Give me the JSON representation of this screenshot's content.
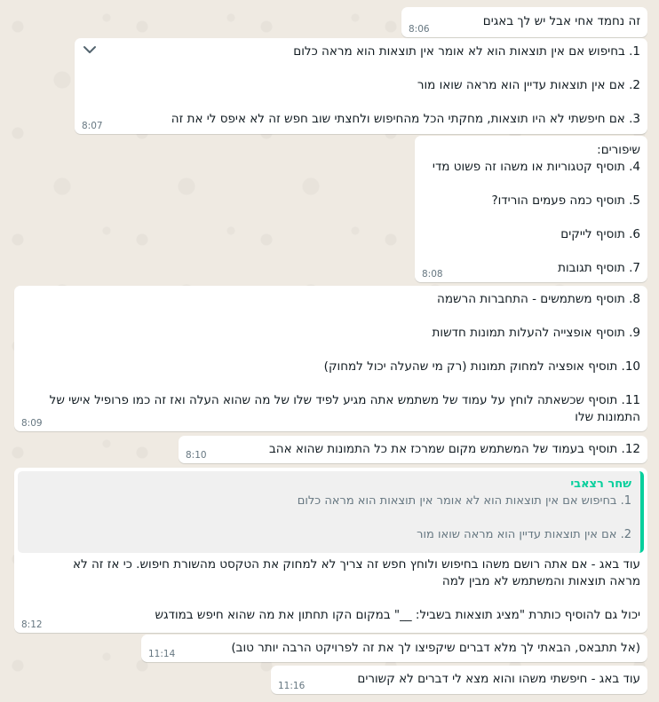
{
  "messages": [
    {
      "time": "8:06",
      "lines": [
        "זה נחמד אחי אבל יש לך באגים"
      ]
    },
    {
      "time": "8:07",
      "lines": [
        "1. בחיפוש אם אין תוצאות הוא לא אומר אין תוצאות הוא מראה כלום",
        "",
        "2. אם אין תוצאות עדיין הוא מראה שואו מור",
        "",
        "3. אם חיפשתי לא היו תוצאות, מחקתי הכל מהחיפוש ולחצתי שוב חפש זה לא איפס לי את זה"
      ]
    },
    {
      "time": "8:08",
      "lines": [
        "שיפורים:",
        "4. תוסיף קטגוריות או משהו זה פשוט מדי",
        "",
        "5. תוסיף כמה פעמים הורידו?",
        "",
        "6. תוסיף לייקים",
        "",
        "7. תוסיף תגובות"
      ]
    },
    {
      "time": "8:09",
      "lines": [
        "8. תוסיף משתמשים - התחברות הרשמה",
        "",
        "9. תוסיף אופצייה להעלות תמונות חדשות",
        "",
        "10. תוסיף אופציה למחוק תמונות (רק מי שהעלה יכול למחוק)",
        "",
        "11. תוסיף שכשאתה לוחץ על עמוד של משתמש אתה מגיע לפיד שלו של מה שהוא העלה ואז זה כמו פרופיל אישי של",
        "התמונות שלו"
      ]
    },
    {
      "time": "8:10",
      "lines": [
        "12. תוסיף בעמוד של המשתמש מקום שמרכז את כל התמונות שהוא אהב"
      ]
    },
    {
      "time": "8:12",
      "quote": {
        "author": "שחר רצאבי",
        "lines": [
          "1. בחיפוש אם אין תוצאות הוא לא אומר אין תוצאות הוא מראה כלום",
          "",
          "2. אם אין תוצאות עדיין הוא מראה שואו מור"
        ]
      },
      "lines": [
        "עוד באג - אם אתה רושם משהו בחיפוש ולוחץ חפש זה צריך לא למחוק את הטקסט מהשורת חיפוש. כי אז זה לא",
        "מראה תוצאות והמשתמש לא מבין למה",
        "",
        "יכול גם להוסיף כותרת \"מציג תוצאות בשביל: __\" במקום הקו תחתון את מה שהוא חיפש במודגש"
      ]
    },
    {
      "time": "11:14",
      "lines": [
        "(אל תתבאס, הבאתי לך מלא דברים שיקפיצו לך את זה לפרויקט הרבה יותר טוב)"
      ]
    },
    {
      "time": "11:16",
      "lines": [
        "עוד באג - חיפשתי משהו והוא מצא לי דברים לא קשורים"
      ]
    }
  ],
  "icons": {
    "menu_chevron": "chevron-down-icon"
  },
  "colors": {
    "background": "#efeae2",
    "bubble": "#ffffff",
    "quote_accent": "#06cf9c",
    "timestamp": "#667781"
  }
}
